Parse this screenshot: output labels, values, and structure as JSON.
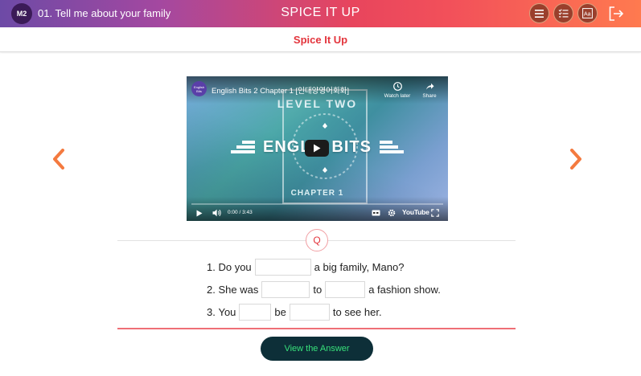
{
  "header": {
    "module_badge": "M2",
    "lesson_title": "01. Tell me about your family",
    "app_title": "SPICE IT UP",
    "icons": [
      "menu-icon",
      "checklist-icon",
      "font-size-icon",
      "exit-icon"
    ]
  },
  "subheader": {
    "title": "Spice It Up"
  },
  "video": {
    "title": "English Bits 2 Chapter 1 [인대양영어회화]",
    "watch_later": "Watch later",
    "share": "Share",
    "art_top": "LEVEL TWO",
    "art_main": "ENGL    BITS",
    "art_bottom": "CHAPTER 1",
    "time": "0:00 / 3:43",
    "logo": "YouTube",
    "channel_avatar_text": "English Bits"
  },
  "quiz": {
    "marker": "Q",
    "questions": [
      {
        "number": "1.",
        "parts": [
          "Do you",
          "a big family, Mano?"
        ]
      },
      {
        "number": "2.",
        "parts": [
          "She was",
          "to",
          "a fashion show."
        ]
      },
      {
        "number": "3.",
        "parts": [
          "You",
          "be",
          "to see her."
        ]
      }
    ],
    "answer_button": "View the Answer"
  },
  "colors": {
    "accent": "#e3343c",
    "arrow": "#f47a3f",
    "button_bg": "#0d2f38",
    "button_text": "#37e07a"
  }
}
